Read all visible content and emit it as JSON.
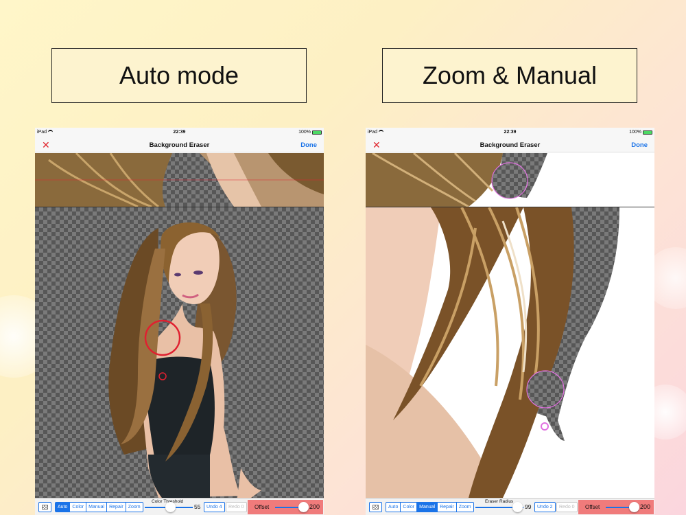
{
  "captions": {
    "left": "Auto mode",
    "right": "Zoom & Manual"
  },
  "left_device": {
    "status": {
      "carrier": "iPad",
      "time": "22:39",
      "battery": "100%"
    },
    "nav": {
      "close": "✕",
      "title": "Background Eraser",
      "done": "Done"
    },
    "toolbar": {
      "modes": [
        "Auto",
        "Color",
        "Manual",
        "Repair",
        "Zoom"
      ],
      "active_mode": "Auto",
      "slider_label": "Color Threshold",
      "slider_value": "55",
      "undo": "Undo 4",
      "redo": "Redo 0",
      "offset_label": "Offset",
      "offset_value": "200"
    }
  },
  "right_device": {
    "status": {
      "carrier": "iPad",
      "time": "22:39",
      "battery": "100%"
    },
    "nav": {
      "close": "✕",
      "title": "Background Eraser",
      "done": "Done"
    },
    "toolbar": {
      "modes": [
        "Auto",
        "Color",
        "Manual",
        "Repair",
        "Zoom"
      ],
      "active_mode": "Manual",
      "slider_label": "Eraser Radius",
      "slider_value": "99",
      "undo": "Undo 2",
      "redo": "Redo 0",
      "offset_label": "Offset",
      "offset_value": "200"
    }
  },
  "colors": {
    "accent": "#1a73e8",
    "close": "#e0242c",
    "offset_panel": "#f07b7b",
    "eraser_ring_auto": "#e02030",
    "eraser_ring_manual": "#e070e0"
  }
}
